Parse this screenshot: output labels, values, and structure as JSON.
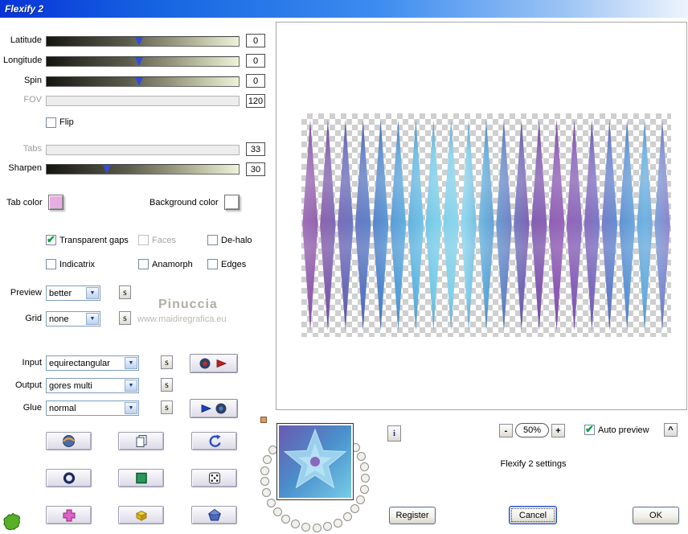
{
  "title": "Flexify 2",
  "sliders": {
    "latitude": {
      "label": "Latitude",
      "value": "0"
    },
    "longitude": {
      "label": "Longitude",
      "value": "0"
    },
    "spin": {
      "label": "Spin",
      "value": "0"
    },
    "fov": {
      "label": "FOV",
      "value": "120"
    },
    "tabs": {
      "label": "Tabs",
      "value": "33"
    },
    "sharpen": {
      "label": "Sharpen",
      "value": "30"
    }
  },
  "flip": {
    "label": "Flip",
    "checked": false
  },
  "color_pickers": {
    "tab_color_label": "Tab color",
    "tab_color": "#e8aee2",
    "background_color_label": "Background color",
    "background_color": "#ffffff"
  },
  "options": {
    "transparent_gaps": {
      "label": "Transparent gaps",
      "checked": true
    },
    "faces": {
      "label": "Faces",
      "checked": false,
      "disabled": true
    },
    "dehalo": {
      "label": "De-halo",
      "checked": false
    },
    "indicatrix": {
      "label": "Indicatrix",
      "checked": false
    },
    "anamorph": {
      "label": "Anamorph",
      "checked": false
    },
    "edges": {
      "label": "Edges",
      "checked": false
    }
  },
  "dropdowns": {
    "preview": {
      "label": "Preview",
      "value": "better"
    },
    "grid": {
      "label": "Grid",
      "value": "none"
    },
    "input": {
      "label": "Input",
      "value": "equirectangular"
    },
    "output": {
      "label": "Output",
      "value": "gores multi"
    },
    "glue": {
      "label": "Glue",
      "value": "normal"
    }
  },
  "s_button_label": "s",
  "watermark": {
    "line1": "Pinuccia",
    "line2": "www.maidiregrafica.eu"
  },
  "zoom": {
    "minus": "-",
    "value": "50%",
    "plus": "+"
  },
  "auto_preview_label": "Auto preview",
  "settings_text": "Flexify 2 settings",
  "buttons": {
    "register": "Register",
    "cancel": "Cancel",
    "ok": "OK",
    "info": "i",
    "scroll_up": "^"
  },
  "icon_buttons": [
    "sphere",
    "duplicate-page",
    "undo",
    "ring",
    "green-square",
    "dice",
    "magenta-cross",
    "yellow-box",
    "blue-pentagon",
    "green-splat"
  ],
  "accent_colors": {
    "titlebar_blue": "#1563e0",
    "check_green": "#0aa040",
    "slider_marker_blue": "#2f4fd8"
  }
}
